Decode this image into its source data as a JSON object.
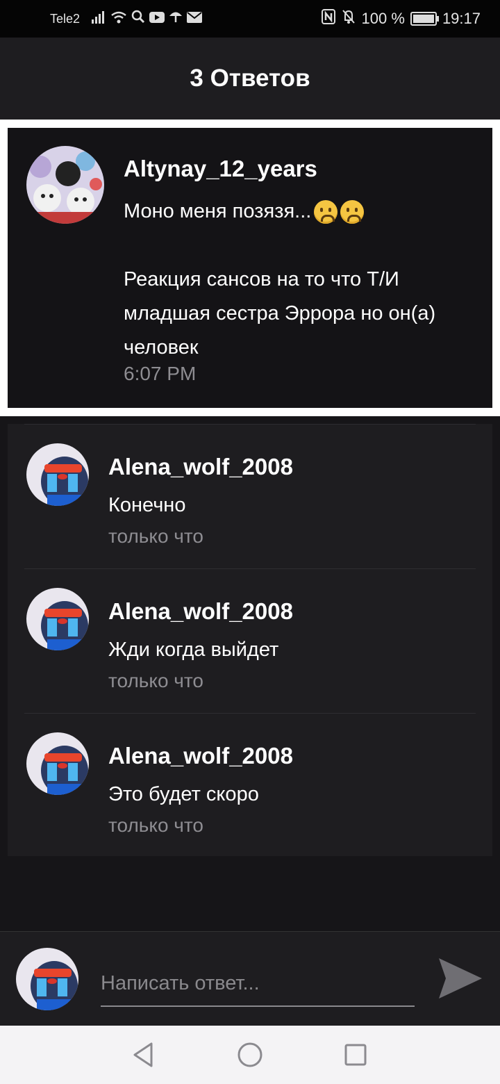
{
  "status_bar": {
    "carrier": "Tele2",
    "battery_text": "100 %",
    "battery_level": 1.0,
    "time": "19:17",
    "icons": [
      "signal-icon",
      "wifi-icon",
      "search-icon",
      "youtube-icon",
      "umbrella-icon",
      "mail-icon",
      "nfc-icon",
      "mute-icon",
      "battery-icon"
    ]
  },
  "header": {
    "title": "3 Ответов"
  },
  "parent_comment": {
    "username": "Altynay_12_years",
    "text_lines": [
      "Моно меня позязя...",
      "",
      "Реакция сансов на то что Т/И",
      "младшая сестра Эррора но он(а)",
      "человек"
    ],
    "emojis": [
      "worried-face-emoji",
      "worried-face-emoji"
    ],
    "time": "6:07 PM"
  },
  "replies": [
    {
      "username": "Alena_wolf_2008",
      "text": "Конечно",
      "time": "только что"
    },
    {
      "username": "Alena_wolf_2008",
      "text": "Жди когда выйдет",
      "time": "только что"
    },
    {
      "username": "Alena_wolf_2008",
      "text": "Это будет скоро",
      "time": "только что"
    }
  ],
  "composer": {
    "placeholder": "Написать ответ...",
    "value": ""
  },
  "colors": {
    "background": "#161518",
    "card": "#1e1d20",
    "muted_text": "#8e8d92",
    "accent_frame": "#ffffff"
  }
}
